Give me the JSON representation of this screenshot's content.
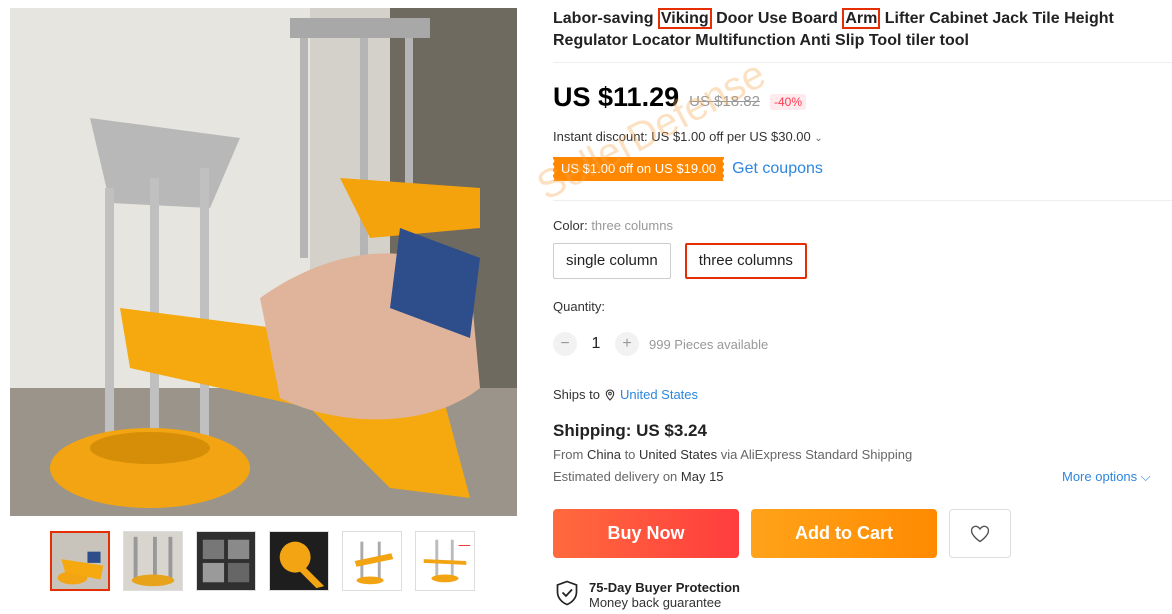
{
  "product": {
    "title_parts": [
      {
        "text": "Labor-saving ",
        "hl": false
      },
      {
        "text": "Viking",
        "hl": true
      },
      {
        "text": " Door Use Board ",
        "hl": false
      },
      {
        "text": "Arm",
        "hl": true
      },
      {
        "text": " Lifter Cabinet Jack Tile Height Regulator Locator Multifunction Anti Slip Tool tiler tool",
        "hl": false
      }
    ]
  },
  "price": {
    "current": "US $11.29",
    "original": "US $18.82",
    "discount": "-40%"
  },
  "instant_discount": "Instant discount: US $1.00 off per US $30.00",
  "coupon": {
    "tag": "US $1.00 off on US $19.00",
    "link": "Get coupons"
  },
  "color": {
    "label": "Color:",
    "selected_value": "three columns",
    "options": [
      "single column",
      "three columns"
    ]
  },
  "quantity": {
    "label": "Quantity:",
    "value": "1",
    "minus": "−",
    "plus": "+",
    "available": "999 Pieces available"
  },
  "ships_to": {
    "label": "Ships to",
    "location": "United States"
  },
  "shipping": {
    "title": "Shipping: US $3.24",
    "from_prefix": "From",
    "from": "China",
    "to_prefix": "to",
    "to": "United States",
    "via": "via AliExpress Standard Shipping",
    "eta_prefix": "Estimated delivery on",
    "eta": "May 15",
    "more_options": "More options"
  },
  "actions": {
    "buy_now": "Buy Now",
    "add_to_cart": "Add to Cart"
  },
  "protection": {
    "title": "75-Day Buyer Protection",
    "subtitle": "Money back guarantee"
  },
  "watermark": "SellerDefense",
  "icons": {
    "pin": "location-pin-icon",
    "heart": "heart-icon",
    "shield": "shield-check-icon",
    "chevron": "chevron-down-icon"
  },
  "colors": {
    "accent_red": "#e62e04",
    "buy_now": "#ff4747",
    "add_to_cart": "#ff9a00",
    "coupon": "#ff8800",
    "link": "#2e86de"
  }
}
